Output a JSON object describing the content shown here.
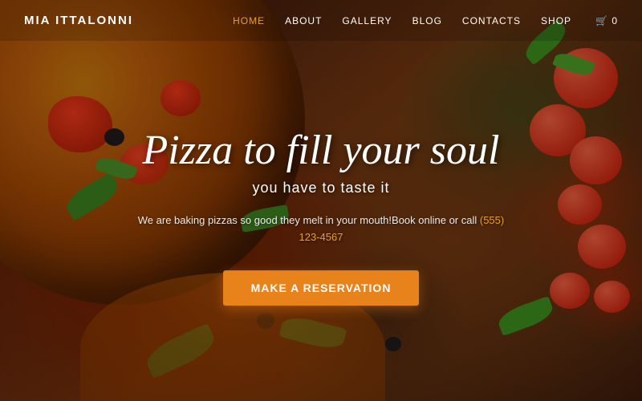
{
  "brand": {
    "name": "MIA ITTALONNI"
  },
  "nav": {
    "links": [
      {
        "label": "HOME",
        "active": true
      },
      {
        "label": "ABOUT",
        "active": false
      },
      {
        "label": "GALLERY",
        "active": false
      },
      {
        "label": "BLOG",
        "active": false
      },
      {
        "label": "CONTACTS",
        "active": false
      },
      {
        "label": "SHOP",
        "active": false
      }
    ],
    "cart_label": "🛒 0"
  },
  "hero": {
    "title": "Pizza to fill your soul",
    "subtitle": "you have to taste it",
    "description": "We are baking pizzas so good they melt in your mouth!Book online or call ",
    "phone": "(555) 123-4567",
    "cta_label": "Make a Reservation"
  }
}
